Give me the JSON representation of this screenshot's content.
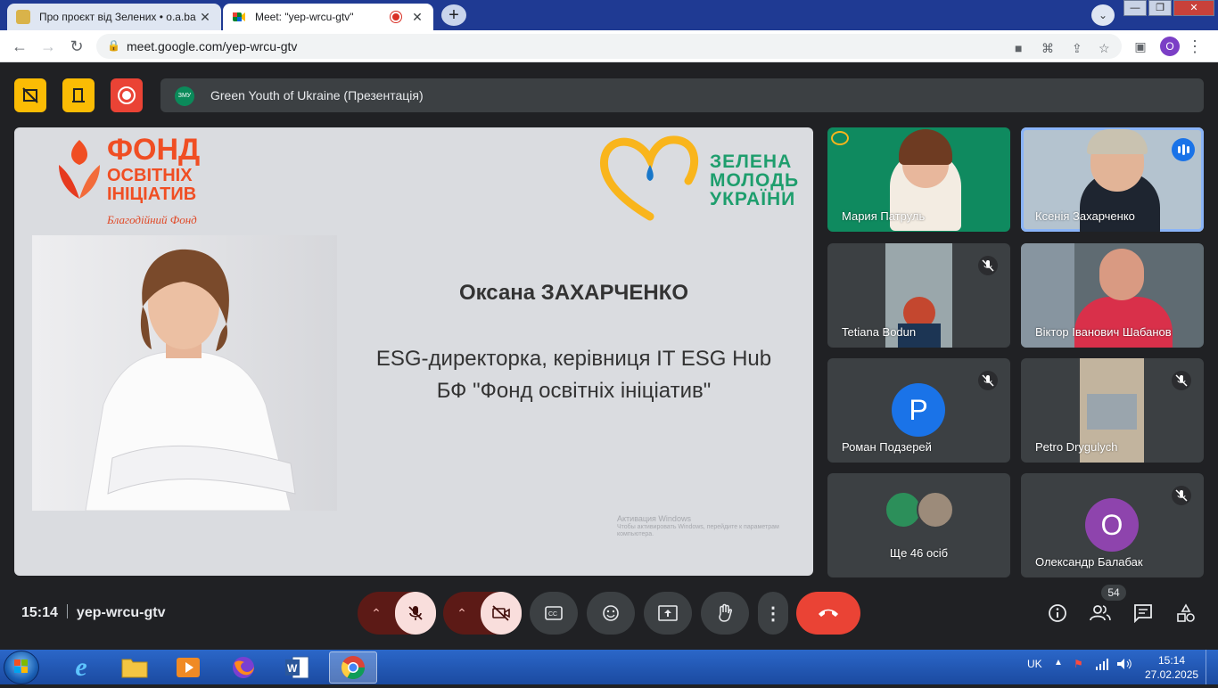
{
  "browser": {
    "tabs": [
      {
        "title": "Про проєкт від Зелених • о.а.ba",
        "close": "✕"
      },
      {
        "title": "Meet: \"yep-wrcu-gtv\"",
        "close": "✕"
      }
    ],
    "new_tab": "+",
    "url": "meet.google.com/yep-wrcu-gtv",
    "profile_initial": "O"
  },
  "meet": {
    "presentation_title": "Green Youth of Ukraine (Презентація)",
    "meeting_code": "yep-wrcu-gtv",
    "time": "15:14",
    "participant_count": "54",
    "colors": {
      "accent": "#8ab4f8",
      "record": "#ea4335",
      "host_controls": "#fbbc04",
      "end_call": "#ea4335"
    }
  },
  "slide": {
    "fund_title_line1": "ФОНД",
    "fund_title_line2": "ОСВІТНІХ",
    "fund_title_line3": "ІНІЦІАТИВ",
    "fund_subtitle": "Благодійний Фонд",
    "partner_line1": "ЗЕЛЕНА",
    "partner_line2": "МОЛОДЬ",
    "partner_line3": "УКРАЇНИ",
    "speaker_name": "Оксана ЗАХАРЧЕНКО",
    "speaker_role_line1": "ESG-директорка, керівниця IT ESG Hub",
    "speaker_role_line2": "БФ \"Фонд освітніх ініціатив\"",
    "watermark_title": "Активация Windows",
    "watermark_sub": "Чтобы активировать Windows, перейдите к параметрам компьютера."
  },
  "participants": [
    {
      "name": "Мария Патруль"
    },
    {
      "name": "Ксенія Захарченко"
    },
    {
      "name": "Tetiana Bodun"
    },
    {
      "name": "Віктор Іванович Шабанов"
    },
    {
      "name": "Роман Подзерей",
      "initial": "P"
    },
    {
      "name": "Petro Drygulych"
    },
    {
      "name": "Ще 46 осіб"
    },
    {
      "name": "Олександр Балабак",
      "initial": "О"
    }
  ],
  "taskbar": {
    "language": "UK",
    "time": "15:14",
    "date": "27.02.2025"
  }
}
